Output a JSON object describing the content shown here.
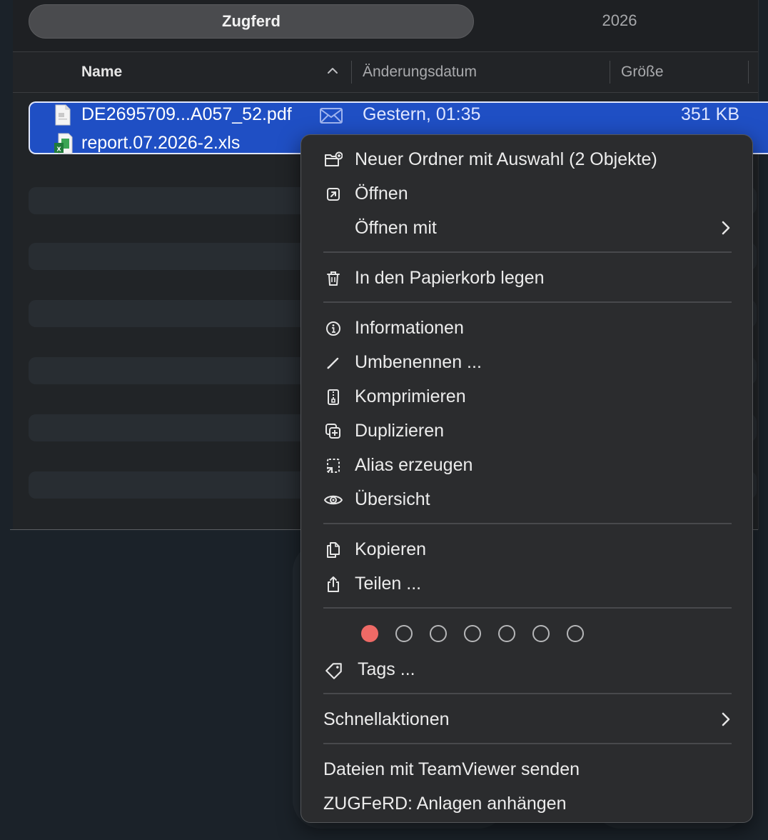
{
  "tabs": [
    {
      "label": "Zugferd",
      "active": true
    },
    {
      "label": "2026",
      "active": false
    }
  ],
  "columns": {
    "name": "Name",
    "date": "Änderungsdatum",
    "size": "Größe",
    "sort": "ascending"
  },
  "files": [
    {
      "name": "DE2695709...A057_52.pdf",
      "date": "Gestern, 01:35",
      "size": "351 KB",
      "icon": "pdf-document-icon",
      "badge": "mail-icon"
    },
    {
      "name": "report.07.2026-2.xls",
      "date": "",
      "size": "",
      "icon": "excel-document-icon"
    }
  ],
  "context_menu": {
    "group1": {
      "new_folder": "Neuer Ordner mit Auswahl (2 Objekte)",
      "open": "Öffnen",
      "open_with": "Öffnen mit"
    },
    "group2": {
      "trash": "In den Papierkorb legen"
    },
    "group3": {
      "info": "Informationen",
      "rename": "Umbenennen ...",
      "compress": "Komprimieren",
      "duplicate": "Duplizieren",
      "alias": "Alias erzeugen",
      "quicklook": "Übersicht"
    },
    "group4": {
      "copy": "Kopieren",
      "share": "Teilen ..."
    },
    "tags": {
      "colors": [
        "#ee6a66",
        "none",
        "none",
        "none",
        "none",
        "none",
        "none"
      ],
      "label": "Tags ..."
    },
    "quick_actions": "Schnellaktionen",
    "teamviewer": "Dateien mit TeamViewer senden",
    "zugferd": "ZUGFeRD: Anlagen anhängen"
  },
  "colors": {
    "selection": "#1f4fc4",
    "menu_bg": "#2b2c2e",
    "accent_red_tag": "#ee6a66"
  }
}
